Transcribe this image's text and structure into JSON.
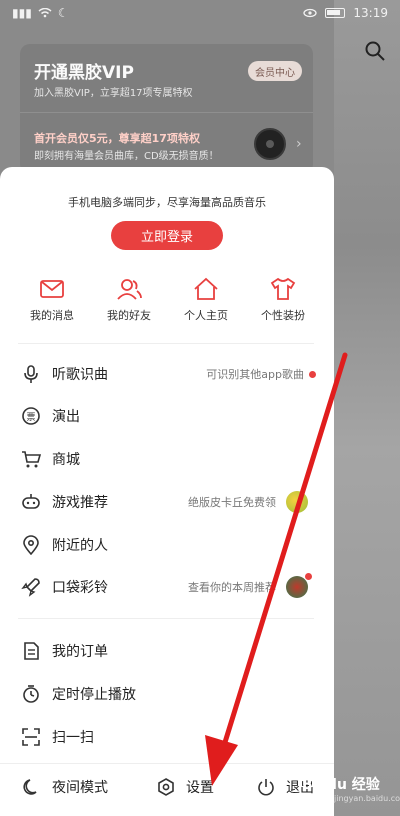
{
  "status_bar": {
    "time": "13:19",
    "signal": "▮▮▮",
    "wifi": "wifi-icon",
    "extra": "☾"
  },
  "vip": {
    "title": "开通黑胶VIP",
    "subtitle": "加入黑胶VIP，立享超17项专属特权",
    "center_label": "会员中心",
    "promo": "首开会员仅5元，尊享超17项特权",
    "promo_sub": "即刻拥有海量会员曲库，CD级无损音质！"
  },
  "drawer": {
    "login_tip": "手机电脑多端同步，尽享海量高品质音乐",
    "login_button": "立即登录",
    "quick": [
      {
        "label": "我的消息",
        "icon": "mail-icon"
      },
      {
        "label": "我的好友",
        "icon": "friends-icon"
      },
      {
        "label": "个人主页",
        "icon": "home-icon"
      },
      {
        "label": "个性装扮",
        "icon": "tshirt-icon"
      }
    ],
    "menu": [
      {
        "label": "听歌识曲",
        "icon": "mic-icon",
        "hint": "可识别其他app歌曲"
      },
      {
        "label": "演出",
        "icon": "ticket-icon"
      },
      {
        "label": "商城",
        "icon": "cart-icon"
      },
      {
        "label": "游戏推荐",
        "icon": "gamepad-icon",
        "hint": "绝版皮卡丘免费领"
      },
      {
        "label": "附近的人",
        "icon": "location-icon"
      },
      {
        "label": "口袋彩铃",
        "icon": "rocket-icon",
        "hint": "查看你的本周推荐"
      }
    ],
    "menu2": [
      {
        "label": "我的订单",
        "icon": "order-icon"
      },
      {
        "label": "定时停止播放",
        "icon": "timer-icon"
      },
      {
        "label": "扫一扫",
        "icon": "scan-icon"
      }
    ],
    "bottom": {
      "night": "夜间模式",
      "settings": "设置",
      "logout": "退出"
    }
  },
  "watermark": {
    "main": "Baidu 经验",
    "sub": "jingyan.baidu.com"
  },
  "colors": {
    "accent": "#e8403f",
    "overlay": "#8a8a8a"
  }
}
